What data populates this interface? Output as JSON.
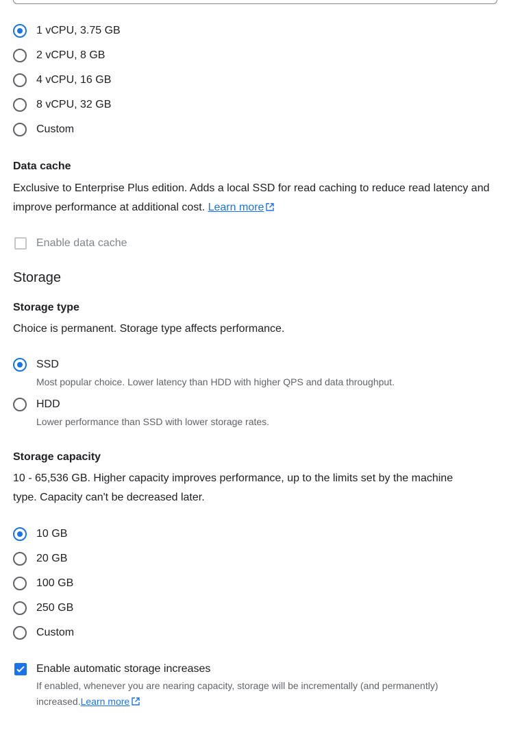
{
  "machine": {
    "options": [
      "1 vCPU, 3.75 GB",
      "2 vCPU, 8 GB",
      "4 vCPU, 16 GB",
      "8 vCPU, 32 GB",
      "Custom"
    ],
    "selected": "1 vCPU, 3.75 GB"
  },
  "data_cache": {
    "heading": "Data cache",
    "description": "Exclusive to Enterprise Plus edition. Adds a local SSD for read caching to reduce read latency and improve performance at additional cost.",
    "learn_more": "Learn more",
    "checkbox_label": "Enable data cache"
  },
  "storage": {
    "title": "Storage",
    "type": {
      "heading": "Storage type",
      "description": "Choice is permanent. Storage type affects performance.",
      "options": [
        {
          "label": "SSD",
          "hint": "Most popular choice. Lower latency than HDD with higher QPS and data throughput."
        },
        {
          "label": "HDD",
          "hint": "Lower performance than SSD with lower storage rates."
        }
      ],
      "selected": "SSD"
    },
    "capacity": {
      "heading": "Storage capacity",
      "description": "10 - 65,536 GB. Higher capacity improves performance, up to the limits set by the machine type. Capacity can't be decreased later.",
      "options": [
        "10 GB",
        "20 GB",
        "100 GB",
        "250 GB",
        "Custom"
      ],
      "selected": "10 GB"
    },
    "auto_increase": {
      "label": "Enable automatic storage increases",
      "hint": "If enabled, whenever you are nearing capacity, storage will be incrementally (and permanently) increased.",
      "learn_more": "Learn more",
      "checked": true
    }
  },
  "colors": {
    "accent": "#1a73e8",
    "text": "#202124",
    "secondary": "#5f6368"
  }
}
